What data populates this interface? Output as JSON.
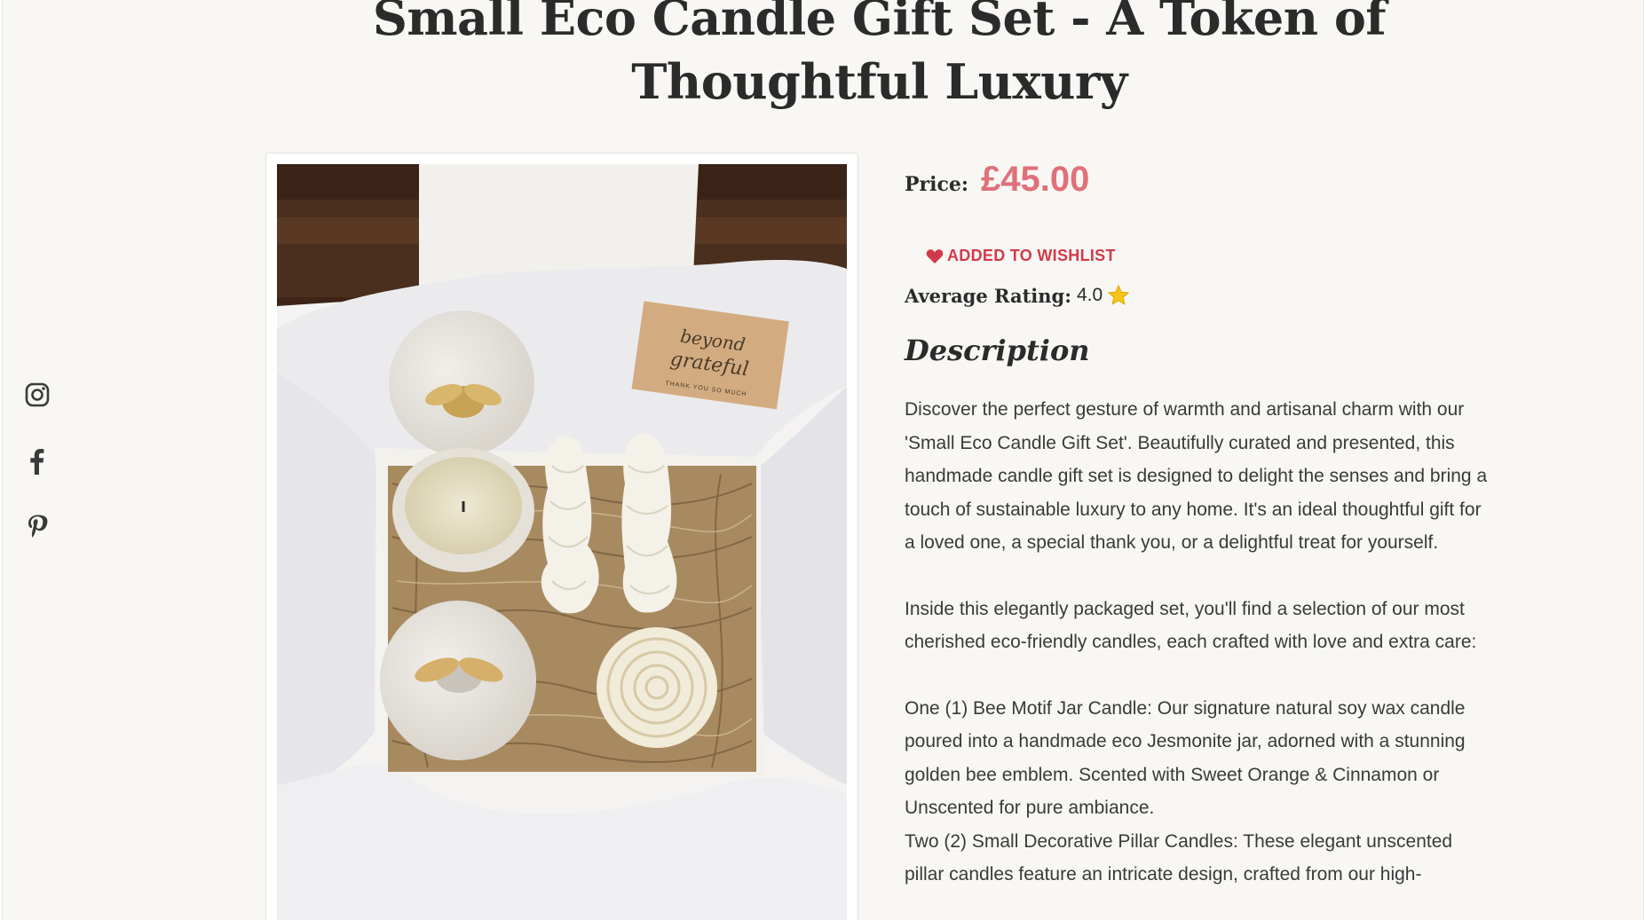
{
  "product": {
    "title": "Small Eco Candle Gift Set - A Token of Thoughtful Luxury",
    "price_label": "Price:",
    "price": "£45.00",
    "wishlist_label": "ADDED TO WISHLIST",
    "rating_label": "Average Rating:",
    "rating_value": "4.0",
    "description_heading": "Description",
    "description": {
      "paragraph_1": "Discover the perfect gesture of warmth and artisanal charm with our 'Small Eco Candle Gift Set'. Beautifully curated and presented, this handmade candle gift set is designed to delight the senses and bring a touch of sustainable luxury to any home. It's an ideal thoughtful gift for a loved one, a special thank you, or a delightful treat for yourself.",
      "paragraph_2": "Inside this elegantly packaged set, you'll find a selection of our most cherished eco-friendly candles, each crafted with love and extra care:",
      "item_1": "One (1) Bee Motif Jar Candle: Our signature natural soy wax candle poured into a handmade eco Jesmonite jar, adorned with a stunning golden bee emblem. Scented with Sweet Orange & Cinnamon or Unscented for pure ambiance.",
      "item_2": "Two (2) Small Decorative Pillar Candles: These elegant unscented pillar candles feature an intricate design, crafted from our high-"
    },
    "card_text": {
      "line_1": "beyond",
      "line_2": "grateful",
      "line_3": "THANK YOU SO MUCH"
    }
  },
  "social": [
    "instagram-icon",
    "facebook-icon",
    "pinterest-icon"
  ],
  "colors": {
    "price": "#e0707a",
    "wishlist": "#d23a4a",
    "star": "#f5c518",
    "text": "#2b2b2b",
    "background": "#f8f7f4"
  }
}
